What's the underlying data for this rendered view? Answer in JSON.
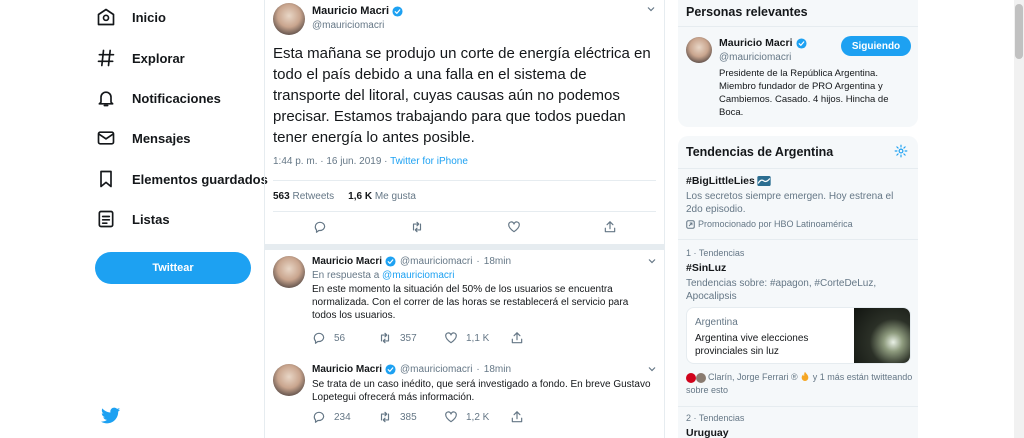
{
  "colors": {
    "accent": "#1da1f2",
    "text": "#14171a",
    "muted": "#657786",
    "border": "#e6ecf0",
    "panel": "#f5f8fa"
  },
  "nav": {
    "items": [
      {
        "icon": "home-icon",
        "label": "Inicio"
      },
      {
        "icon": "hashtag-icon",
        "label": "Explorar"
      },
      {
        "icon": "bell-icon",
        "label": "Notificaciones"
      },
      {
        "icon": "envelope-icon",
        "label": "Mensajes"
      },
      {
        "icon": "bookmark-icon",
        "label": "Elementos guardados"
      },
      {
        "icon": "list-icon",
        "label": "Listas"
      }
    ],
    "tweet_button": "Twittear"
  },
  "main_tweet": {
    "name": "Mauricio Macri",
    "handle": "@mauriciomacri",
    "text": "Esta mañana se produjo un corte de energía eléctrica en todo el país debido a una falla en el sistema de transporte del litoral, cuyas causas aún no podemos precisar. Estamos trabajando para que todos puedan tener energía lo antes posible.",
    "time": "1:44 p. m. · 16 jun. 2019 · ",
    "source": "Twitter for iPhone",
    "retweets_count": "563",
    "retweets_label": "Retweets",
    "likes_count": "1,6 K",
    "likes_label": "Me gusta"
  },
  "replies": [
    {
      "name": "Mauricio Macri",
      "handle": "@mauriciomacri",
      "dot": "·",
      "time": "18min",
      "in_reply_prefix": "En respuesta a ",
      "in_reply_handle": "@mauriciomacri",
      "text": "En este momento la situación del 50% de los usuarios se encuentra normalizada. Con el correr de las horas se restablecerá el servicio para todos los usuarios.",
      "replies": "56",
      "retweets": "357",
      "likes": "1,1 K"
    },
    {
      "name": "Mauricio Macri",
      "handle": "@mauriciomacri",
      "dot": "·",
      "time": "18min",
      "text": "Se trata de un caso inédito, que será investigado a fondo. En breve Gustavo Lopetegui ofrecerá más información.",
      "replies": "234",
      "retweets": "385",
      "likes": "1,2 K"
    }
  ],
  "relevant": {
    "title": "Personas relevantes",
    "name": "Mauricio Macri",
    "handle": "@mauriciomacri",
    "follow_label": "Siguiendo",
    "bio": "Presidente de la República Argentina. Miembro fundador de PRO Argentina y Cambiemos. Casado. 4 hijos. Hincha de Boca."
  },
  "trends": {
    "title": "Tendencias de Argentina",
    "promoted": {
      "tag": "#BigLittleLies",
      "desc": "Los secretos siempre emergen. Hoy estrena el 2do episodio.",
      "promo": "Promocionado por HBO Latinoamérica"
    },
    "items": [
      {
        "rank": "1 · Tendencias",
        "tag": "#SinLuz",
        "desc": "Tendencias sobre: #apagon, #CorteDeLuz, Apocalipsis",
        "news_source": "Argentina",
        "news_headline": "Argentina vive elecciones provinciales sin luz",
        "social_names": "Clarín, Jorge Ferrari ®",
        "social_rest": " y 1 más están twitteando sobre esto"
      },
      {
        "rank": "2 · Tendencias",
        "tag": "Uruguay"
      }
    ]
  }
}
